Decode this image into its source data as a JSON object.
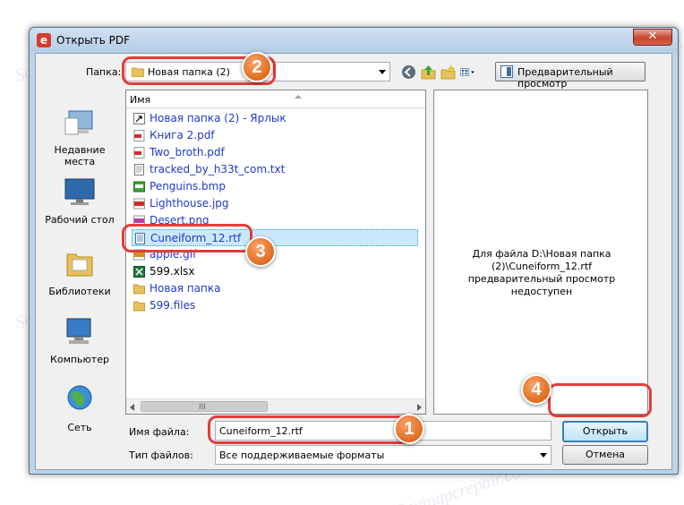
{
  "window": {
    "title": "Открыть PDF",
    "close_glyph": "✕",
    "app_glyph": "e"
  },
  "toolbar": {
    "folder_label": "Папка:",
    "folder_value": "Новая папка (2)",
    "preview_button": "Предварительный просмотр"
  },
  "places": [
    {
      "label_line1": "Недавние",
      "label_line2": "места",
      "icon": "recent-places-icon"
    },
    {
      "label_line1": "Рабочий стол",
      "label_line2": "",
      "icon": "desktop-icon"
    },
    {
      "label_line1": "Библиотеки",
      "label_line2": "",
      "icon": "libraries-icon"
    },
    {
      "label_line1": "Компьютер",
      "label_line2": "",
      "icon": "computer-icon"
    },
    {
      "label_line1": "Сеть",
      "label_line2": "",
      "icon": "network-icon"
    }
  ],
  "file_list": {
    "column_header": "Имя",
    "scroll_grip": "III",
    "items": [
      {
        "name": "Новая папка (2) - Ярлык",
        "icon": "shortcut-icon",
        "color": "blue"
      },
      {
        "name": "Книга 2.pdf",
        "icon": "pdf-icon",
        "color": "blue"
      },
      {
        "name": "Two_broth.pdf",
        "icon": "pdf-icon",
        "color": "blue"
      },
      {
        "name": "tracked_by_h33t_com.txt",
        "icon": "txt-icon",
        "color": "blue"
      },
      {
        "name": "Penguins.bmp",
        "icon": "bmp-icon",
        "color": "blue"
      },
      {
        "name": "Lighthouse.jpg",
        "icon": "jpg-icon",
        "color": "blue"
      },
      {
        "name": "Desert.png",
        "icon": "png-icon",
        "color": "blue"
      },
      {
        "name": "Cuneiform_12.rtf",
        "icon": "rtf-icon",
        "color": "blue",
        "selected": true
      },
      {
        "name": "apple.gif",
        "icon": "gif-icon",
        "color": "blue"
      },
      {
        "name": "599.xlsx",
        "icon": "xlsx-icon",
        "color": "black"
      },
      {
        "name": "Новая папка",
        "icon": "folder-icon",
        "color": "blue"
      },
      {
        "name": "599.files",
        "icon": "folder-icon",
        "color": "blue"
      }
    ]
  },
  "preview": {
    "message": "Для файла D:\\Новая папка (2)\\Cuneiform_12.rtf предварительный просмотр недоступен"
  },
  "filename": {
    "label": "Имя файла:",
    "value": "Cuneiform_12.rtf"
  },
  "filetype": {
    "label": "Тип файлов:",
    "value": "Все поддерживаемые форматы"
  },
  "buttons": {
    "open": "Открыть",
    "cancel": "Отмена"
  },
  "annotations": {
    "badge1": "1",
    "badge2": "2",
    "badge3": "3",
    "badge4": "4"
  },
  "watermark": "Sovingpcrepair.com",
  "colors": {
    "highlight": "#e53b3b",
    "badge": "#e06b1f",
    "link_blue": "#1f3acb",
    "selection": "#cce8ff"
  }
}
